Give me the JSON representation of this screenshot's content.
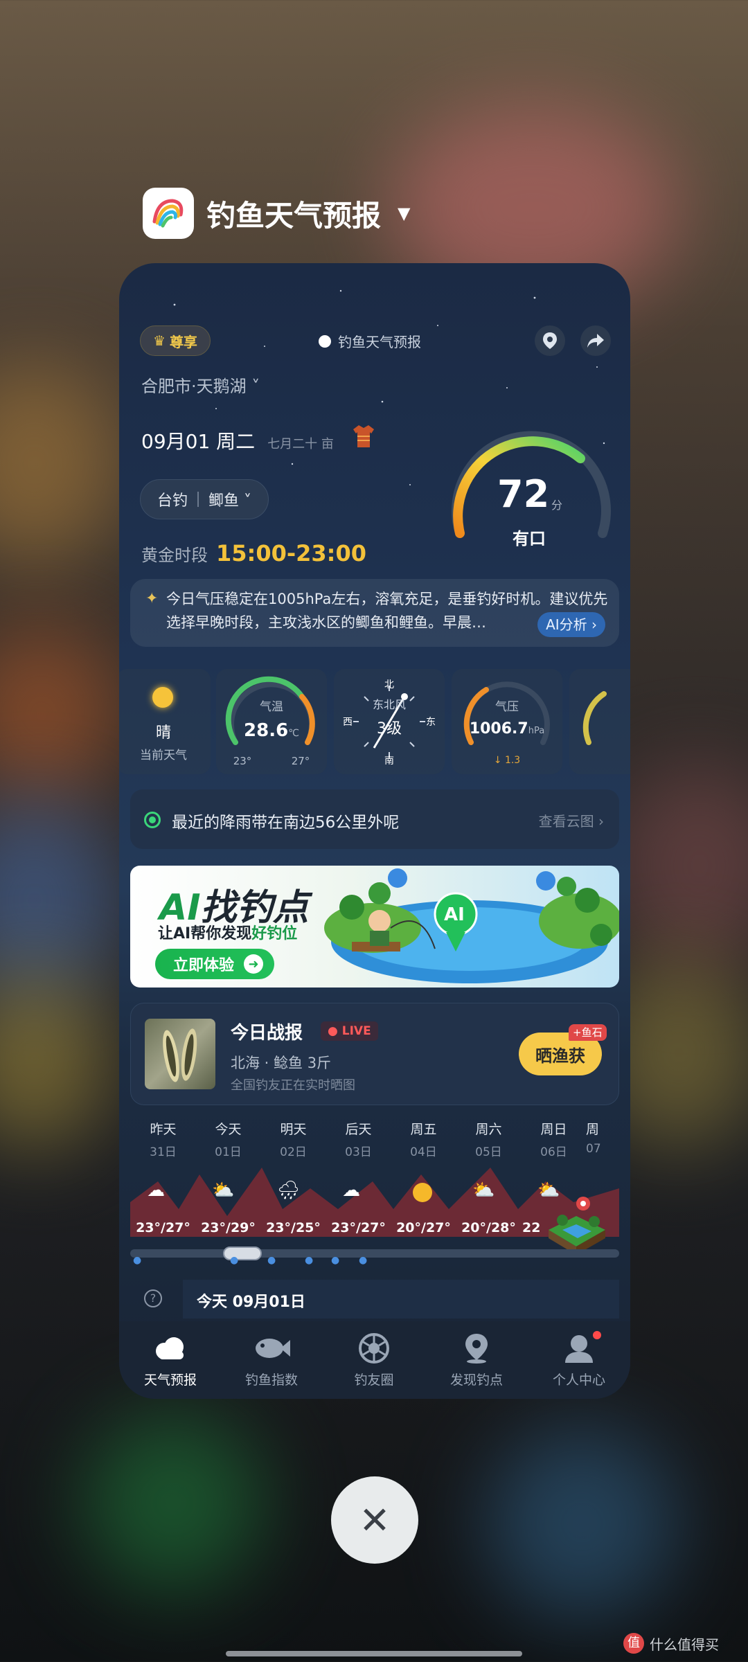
{
  "app": {
    "name": "钓鱼天气预报"
  },
  "header": {
    "vip_label": "尊享",
    "title": "钓鱼天气预报",
    "location": "合肥市·天鹅湖 ˅"
  },
  "date": {
    "main": "09月01 周二",
    "lunar": "七月二十 亩"
  },
  "species": {
    "method": "台钓",
    "fish": "鲫鱼 ˅"
  },
  "golden_time": {
    "label": "黄金时段",
    "value": "15:00-23:00"
  },
  "score": {
    "value": "72",
    "unit": "分",
    "label": "有口"
  },
  "ai_analysis": {
    "text": "今日气压稳定在1005hPa左右，溶氧充足，是垂钓好时机。建议优先选择早晚时段，主攻浅水区的鲫鱼和鲤鱼。早晨…",
    "button": "AI分析 ›"
  },
  "weather": {
    "condition": "晴",
    "condition_label": "当前天气",
    "temp_label": "气温",
    "temp_value": "28.6",
    "temp_unit": "℃",
    "temp_min": "23°",
    "temp_max": "27°",
    "wind_n": "北",
    "wind_dir": "东北风",
    "wind_level": "3级",
    "wind_w": "西",
    "wind_e": "东",
    "wind_s": "南",
    "pressure_label": "气压",
    "pressure_value": "1006.7",
    "pressure_unit": "hPa",
    "pressure_change": "↓ 1.3"
  },
  "rain_notice": {
    "text": "最近的降雨带在南边56公里外呢",
    "link": "查看云图 ›"
  },
  "banner": {
    "title_ai": "AI",
    "title_rest": "找钓点",
    "subtitle_pre": "让AI帮你发现",
    "subtitle_hl": "好钓位",
    "button": "立即体验",
    "pin_label": "AI"
  },
  "report": {
    "title": "今日战报",
    "live": "● LIVE",
    "line": "北海 · 鲶鱼 3斤",
    "sub": "全国钓友正在实时晒图",
    "button": "晒渔获",
    "badge": "+鱼石"
  },
  "forecast": [
    {
      "day": "昨天",
      "date": "31日",
      "temp": "23°/27°",
      "icon": "cloud"
    },
    {
      "day": "今天",
      "date": "01日",
      "temp": "23°/29°",
      "icon": "sun-cloud"
    },
    {
      "day": "明天",
      "date": "02日",
      "temp": "23°/25°",
      "icon": "rain"
    },
    {
      "day": "后天",
      "date": "03日",
      "temp": "23°/27°",
      "icon": "cloud"
    },
    {
      "day": "周五",
      "date": "04日",
      "temp": "20°/27°",
      "icon": "sun"
    },
    {
      "day": "周六",
      "date": "05日",
      "temp": "20°/28°",
      "icon": "sun-cloud"
    },
    {
      "day": "周日",
      "date": "06日",
      "temp": "22",
      "icon": "sun-cloud"
    },
    {
      "day": "周",
      "date": "07",
      "temp": "°",
      "icon": "cloud"
    }
  ],
  "day_row": {
    "help": "?",
    "label": "今天 09月01日"
  },
  "tabs": [
    {
      "label": "天气预报",
      "icon": "cloud-icon"
    },
    {
      "label": "钓鱼指数",
      "icon": "fish-icon"
    },
    {
      "label": "钓友圈",
      "icon": "aperture-icon"
    },
    {
      "label": "发现钓点",
      "icon": "location-pin-icon"
    },
    {
      "label": "个人中心",
      "icon": "user-icon"
    }
  ],
  "system": {
    "close": "✕",
    "watermark": "什么值得买",
    "watermark_badge": "值"
  },
  "colors": {
    "accent_gold": "#f3c13a",
    "accent_green": "#19b34e",
    "card_bg": "#1f3352"
  }
}
